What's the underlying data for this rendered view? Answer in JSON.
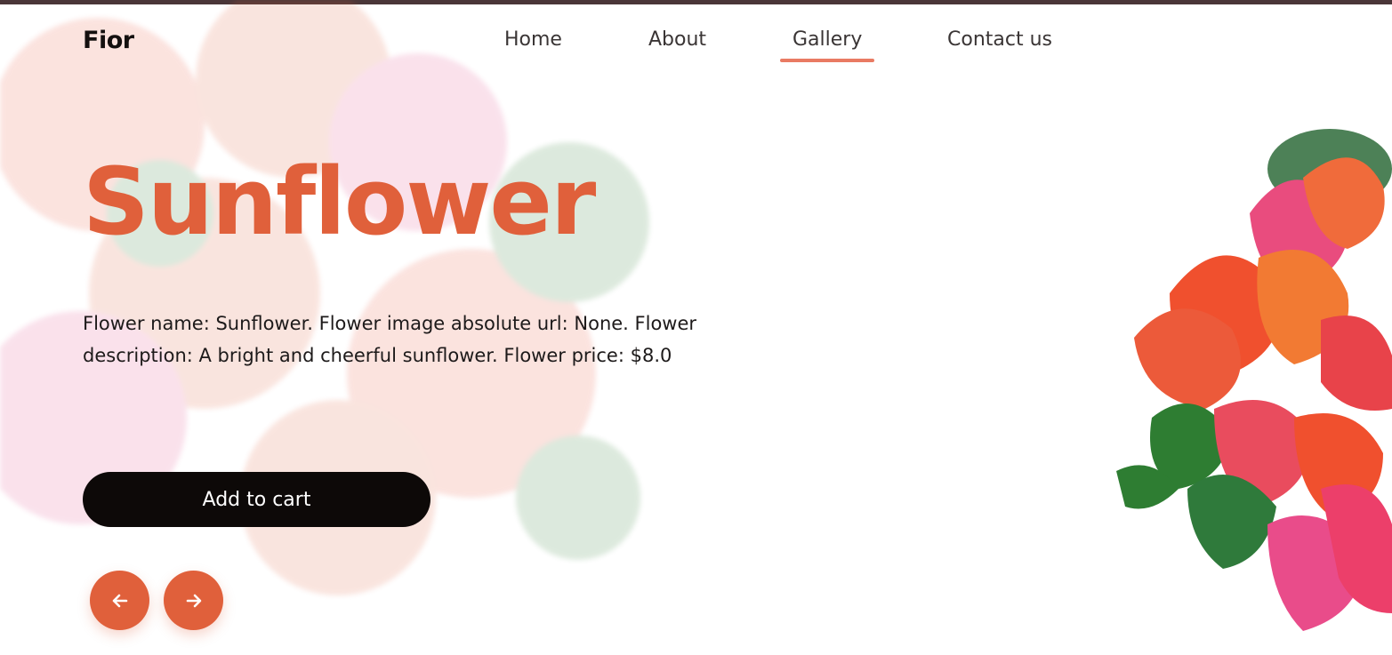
{
  "brand": {
    "logo_text": "Fior"
  },
  "nav": {
    "items": [
      {
        "label": "Home",
        "active": false
      },
      {
        "label": "About",
        "active": false
      },
      {
        "label": "Gallery",
        "active": true
      },
      {
        "label": "Contact us",
        "active": false
      }
    ]
  },
  "hero": {
    "title": "Sunflower",
    "description": "Flower name: Sunflower. Flower image absolute url: None. Flower description: A bright and cheerful sunflower. Flower price: $8.0",
    "cart_button_label": "Add to cart"
  },
  "carousel": {
    "prev_icon": "arrow-left-icon",
    "next_icon": "arrow-right-icon"
  },
  "colors": {
    "accent": "#e0603b",
    "nav_underline": "#e97b63",
    "button_dark": "#0d0908",
    "top_strip": "#4a3638"
  }
}
